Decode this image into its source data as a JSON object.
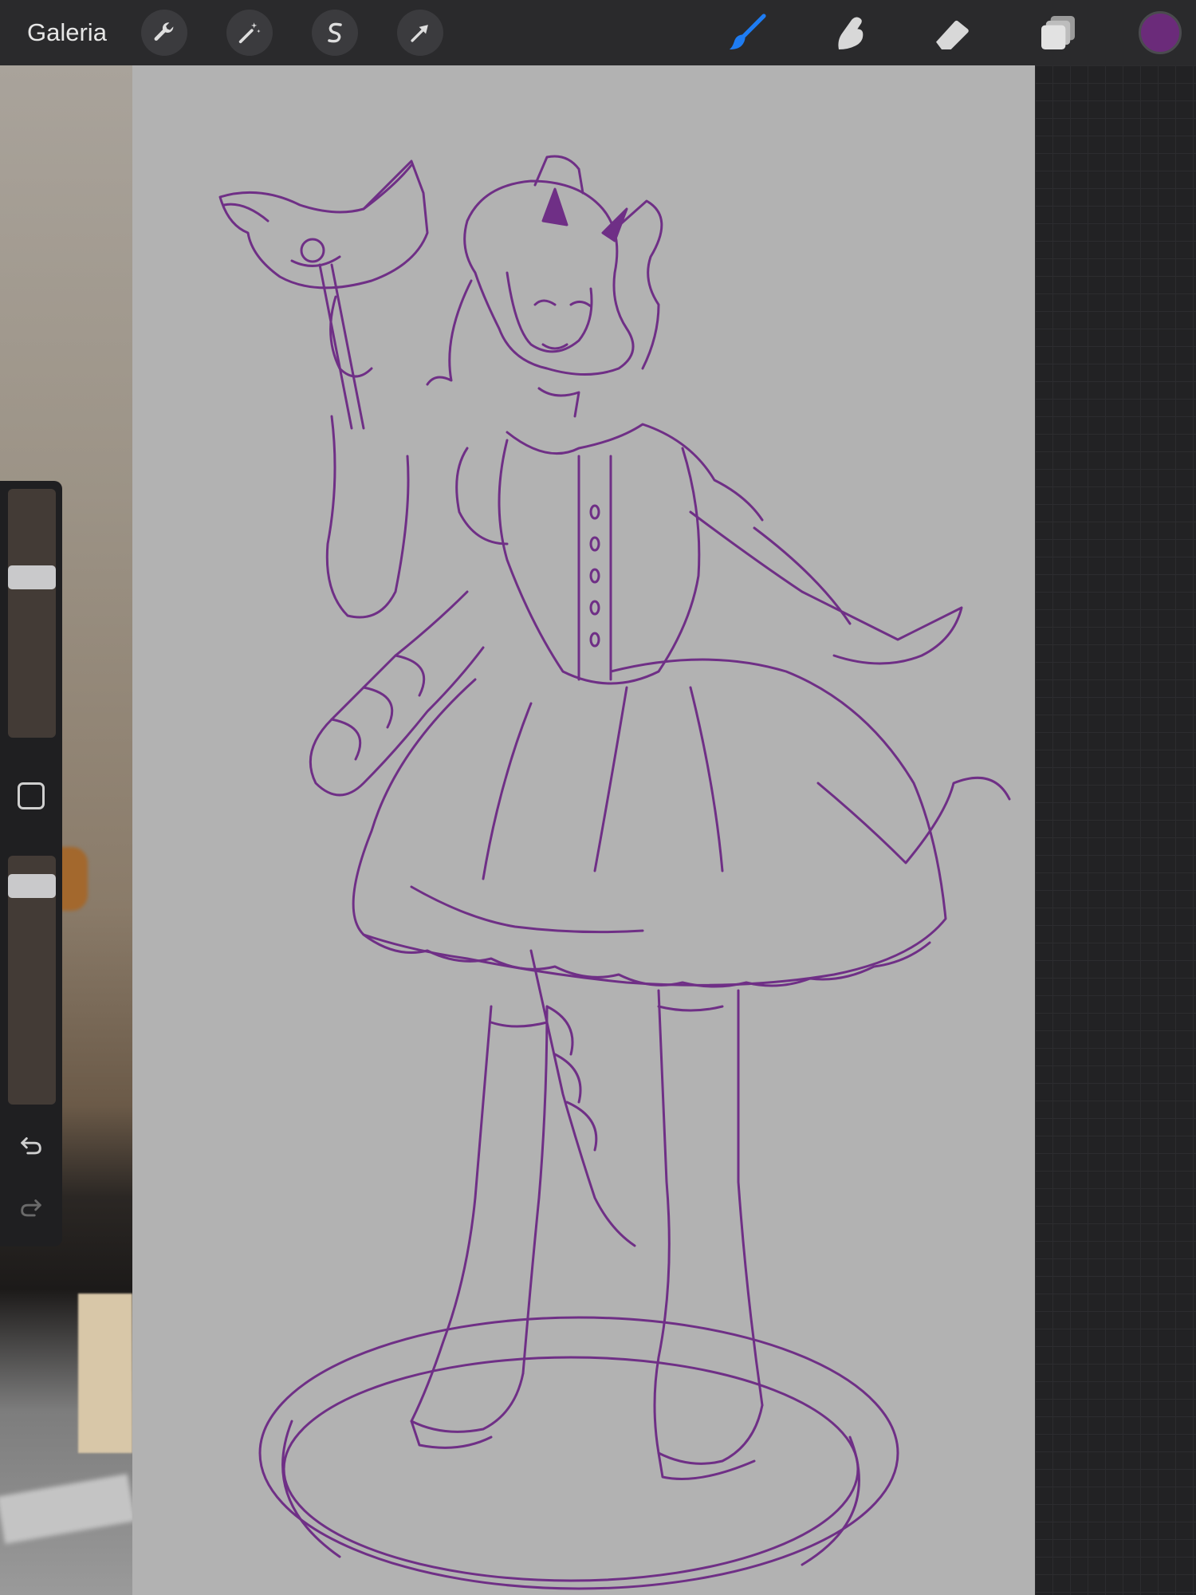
{
  "toolbar": {
    "gallery_label": "Galeria",
    "tools": [
      {
        "name": "actions",
        "icon": "wrench-icon"
      },
      {
        "name": "adjustments",
        "icon": "magic-wand-icon"
      },
      {
        "name": "selection",
        "icon": "selection-s-icon"
      },
      {
        "name": "transform",
        "icon": "arrow-cursor-icon"
      }
    ],
    "paint_tools": [
      {
        "name": "brush",
        "icon": "brush-icon",
        "active": true
      },
      {
        "name": "smudge",
        "icon": "smudge-finger-icon",
        "active": false
      },
      {
        "name": "eraser",
        "icon": "eraser-icon",
        "active": false
      },
      {
        "name": "layers",
        "icon": "layers-icon",
        "active": false
      }
    ],
    "current_color": "#6b2b7a"
  },
  "colors": {
    "active_tool": "#1e7cf2",
    "inactive_tool": "#d8d8d8",
    "stroke": "#6f2f86",
    "canvas": "#b2b2b2"
  },
  "sidebar": {
    "brush_size_level": 0.66,
    "opacity_level": 0.92,
    "undo_icon": "undo-arrow-icon",
    "redo_icon": "redo-arrow-icon",
    "modify_icon": "square-modify-icon"
  }
}
